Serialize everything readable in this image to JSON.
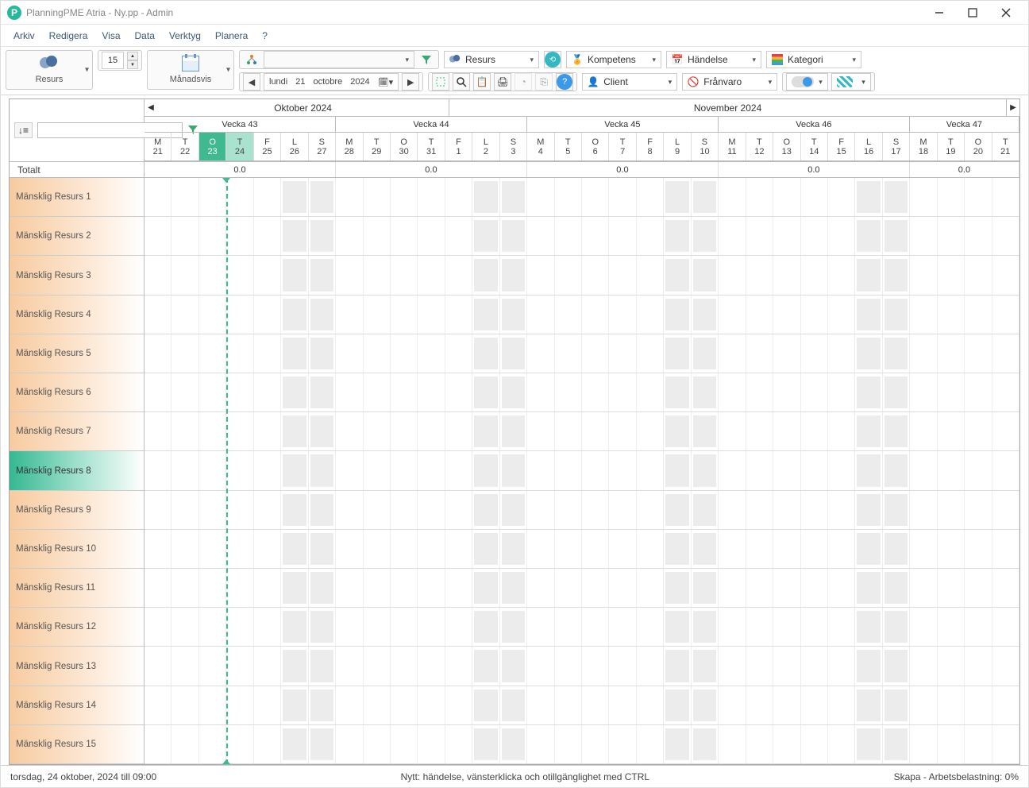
{
  "window": {
    "title": "PlanningPME Atria - Ny.pp - Admin"
  },
  "menu": [
    "Arkiv",
    "Redigera",
    "Visa",
    "Data",
    "Verktyg",
    "Planera",
    "?"
  ],
  "toolbar": {
    "resource_label": "Resurs",
    "monthly_label": "Månadsvis",
    "spin_value": "15",
    "date_parts": {
      "dow": "lundi",
      "day": "21",
      "month": "octobre",
      "year": "2024"
    },
    "dd_resurs": "Resurs",
    "dd_kompetens": "Kompetens",
    "dd_handelse": "Händelse",
    "dd_kategori": "Kategori",
    "dd_client": "Client",
    "dd_franvaro": "Frånvaro"
  },
  "timeline": {
    "months": [
      {
        "label": "Oktober 2024",
        "days": 11
      },
      {
        "label": "November 2024",
        "days": 21
      }
    ],
    "weeks": [
      {
        "label": "Vecka 43",
        "days": 7
      },
      {
        "label": "Vecka 44",
        "days": 7
      },
      {
        "label": "Vecka 45",
        "days": 7
      },
      {
        "label": "Vecka 46",
        "days": 7
      },
      {
        "label": "Vecka 47",
        "days": 4
      }
    ],
    "totals_label": "Totalt",
    "totals": [
      "0.0",
      "0.0",
      "0.0",
      "0.0",
      "0.0"
    ],
    "days": [
      {
        "d": "M",
        "n": "21",
        "we": false
      },
      {
        "d": "T",
        "n": "22",
        "we": false
      },
      {
        "d": "O",
        "n": "23",
        "we": false,
        "today": true
      },
      {
        "d": "T",
        "n": "24",
        "we": false,
        "tomorrow": true
      },
      {
        "d": "F",
        "n": "25",
        "we": false
      },
      {
        "d": "L",
        "n": "26",
        "we": true
      },
      {
        "d": "S",
        "n": "27",
        "we": true
      },
      {
        "d": "M",
        "n": "28",
        "we": false
      },
      {
        "d": "T",
        "n": "29",
        "we": false
      },
      {
        "d": "O",
        "n": "30",
        "we": false
      },
      {
        "d": "T",
        "n": "31",
        "we": false
      },
      {
        "d": "F",
        "n": "1",
        "we": false
      },
      {
        "d": "L",
        "n": "2",
        "we": true
      },
      {
        "d": "S",
        "n": "3",
        "we": true
      },
      {
        "d": "M",
        "n": "4",
        "we": false
      },
      {
        "d": "T",
        "n": "5",
        "we": false
      },
      {
        "d": "O",
        "n": "6",
        "we": false
      },
      {
        "d": "T",
        "n": "7",
        "we": false
      },
      {
        "d": "F",
        "n": "8",
        "we": false
      },
      {
        "d": "L",
        "n": "9",
        "we": true
      },
      {
        "d": "S",
        "n": "10",
        "we": true
      },
      {
        "d": "M",
        "n": "11",
        "we": false
      },
      {
        "d": "T",
        "n": "12",
        "we": false
      },
      {
        "d": "O",
        "n": "13",
        "we": false
      },
      {
        "d": "T",
        "n": "14",
        "we": false
      },
      {
        "d": "F",
        "n": "15",
        "we": false
      },
      {
        "d": "L",
        "n": "16",
        "we": true
      },
      {
        "d": "S",
        "n": "17",
        "we": true
      },
      {
        "d": "M",
        "n": "18",
        "we": false
      },
      {
        "d": "T",
        "n": "19",
        "we": false
      },
      {
        "d": "O",
        "n": "20",
        "we": false
      },
      {
        "d": "T",
        "n": "21",
        "we": false
      }
    ]
  },
  "resources": [
    {
      "name": "Mänsklig Resurs 1"
    },
    {
      "name": "Mänsklig Resurs 2"
    },
    {
      "name": "Mänsklig Resurs 3"
    },
    {
      "name": "Mänsklig Resurs 4"
    },
    {
      "name": "Mänsklig Resurs 5"
    },
    {
      "name": "Mänsklig Resurs 6"
    },
    {
      "name": "Mänsklig Resurs 7"
    },
    {
      "name": "Mänsklig Resurs 8",
      "selected": true
    },
    {
      "name": "Mänsklig Resurs 9"
    },
    {
      "name": "Mänsklig Resurs 10"
    },
    {
      "name": "Mänsklig Resurs 11"
    },
    {
      "name": "Mänsklig Resurs 12"
    },
    {
      "name": "Mänsklig Resurs 13"
    },
    {
      "name": "Mänsklig Resurs 14"
    },
    {
      "name": "Mänsklig Resurs 15"
    }
  ],
  "status": {
    "left": "torsdag, 24 oktober, 2024 till 09:00",
    "center": "Nytt: händelse, vänsterklicka och otillgänglighet med CTRL",
    "right": "Skapa - Arbetsbelastning: 0%"
  }
}
